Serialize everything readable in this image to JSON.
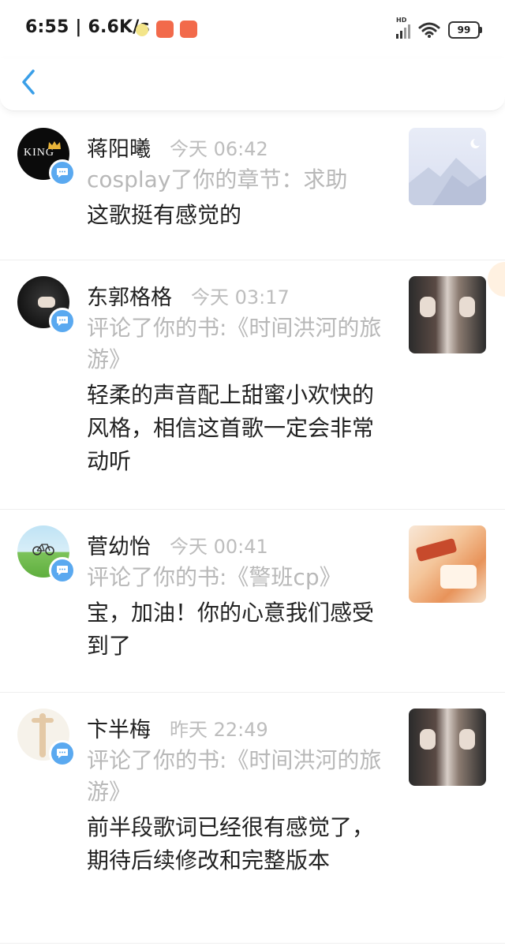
{
  "status_bar": {
    "time": "6:55",
    "net_speed": "| 6.6K/s",
    "hd_label": "HD",
    "battery": "99"
  },
  "header": {
    "back_icon": "chevron-left-icon"
  },
  "notifications": [
    {
      "name": "蒋阳曦",
      "time": "今天 06:42",
      "action": "cosplay了你的章节：求助",
      "comment": "这歌挺有感觉的",
      "avatar_text": "KING"
    },
    {
      "name": "东郭格格",
      "time": "今天 03:17",
      "action": "评论了你的书:《时间洪河的旅游》",
      "comment": "轻柔的声音配上甜蜜小欢快的风格，相信这首歌一定会非常动听"
    },
    {
      "name": "菅幼怡",
      "time": "今天 00:41",
      "action": "评论了你的书:《警班cp》",
      "comment": "宝，加油！你的心意我们感受到了"
    },
    {
      "name": "卞半梅",
      "time": "昨天 22:49",
      "action": "评论了你的书:《时间洪河的旅游》",
      "comment": "前半段歌词已经很有感觉了，期待后续修改和完整版本"
    }
  ],
  "colors": {
    "accent": "#3a9fe8",
    "badge": "#5aa9f0",
    "muted_text": "#b8b8b8"
  }
}
